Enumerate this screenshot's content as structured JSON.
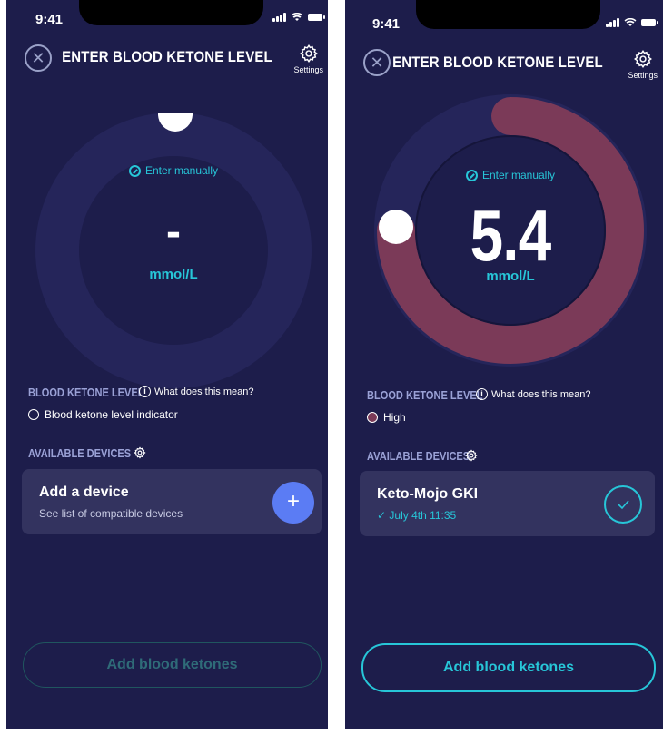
{
  "status": {
    "time": "9:41"
  },
  "header": {
    "title": "ENTER BLOOD KETONE LEVEL",
    "settings_label": "Settings"
  },
  "screens": [
    {
      "enter_manually": "Enter manually",
      "value": "-",
      "unit": "mmol/L",
      "gauge_fill_fraction": 0,
      "section_level_label": "BLOOD KETONE LEVEL",
      "what_does_this_mean": "What does this mean?",
      "indicator_label": "Blood ketone level indicator",
      "devices_label": "AVAILABLE DEVICES",
      "device": {
        "name": "Add a device",
        "subtitle": "See list of compatible devices"
      },
      "button_label": "Add blood ketones",
      "button_enabled": false
    },
    {
      "enter_manually": "Enter manually",
      "value": "5.4",
      "unit": "mmol/L",
      "gauge_fill_fraction": 0.75,
      "section_level_label": "BLOOD KETONE LEVEL",
      "what_does_this_mean": "What does this mean?",
      "indicator_label": "High",
      "devices_label": "AVAILABLE DEVICES",
      "device": {
        "name": "Keto-Mojo GKI",
        "subtitle": "July 4th 11:35"
      },
      "button_label": "Add blood ketones",
      "button_enabled": true
    }
  ],
  "colors": {
    "background": "#1d1d4b",
    "ring": "#25255a",
    "inner": "#1d1d4b",
    "accent": "#27c6d8",
    "high": "#7b3a58",
    "button_blue": "#5b7cf4"
  }
}
